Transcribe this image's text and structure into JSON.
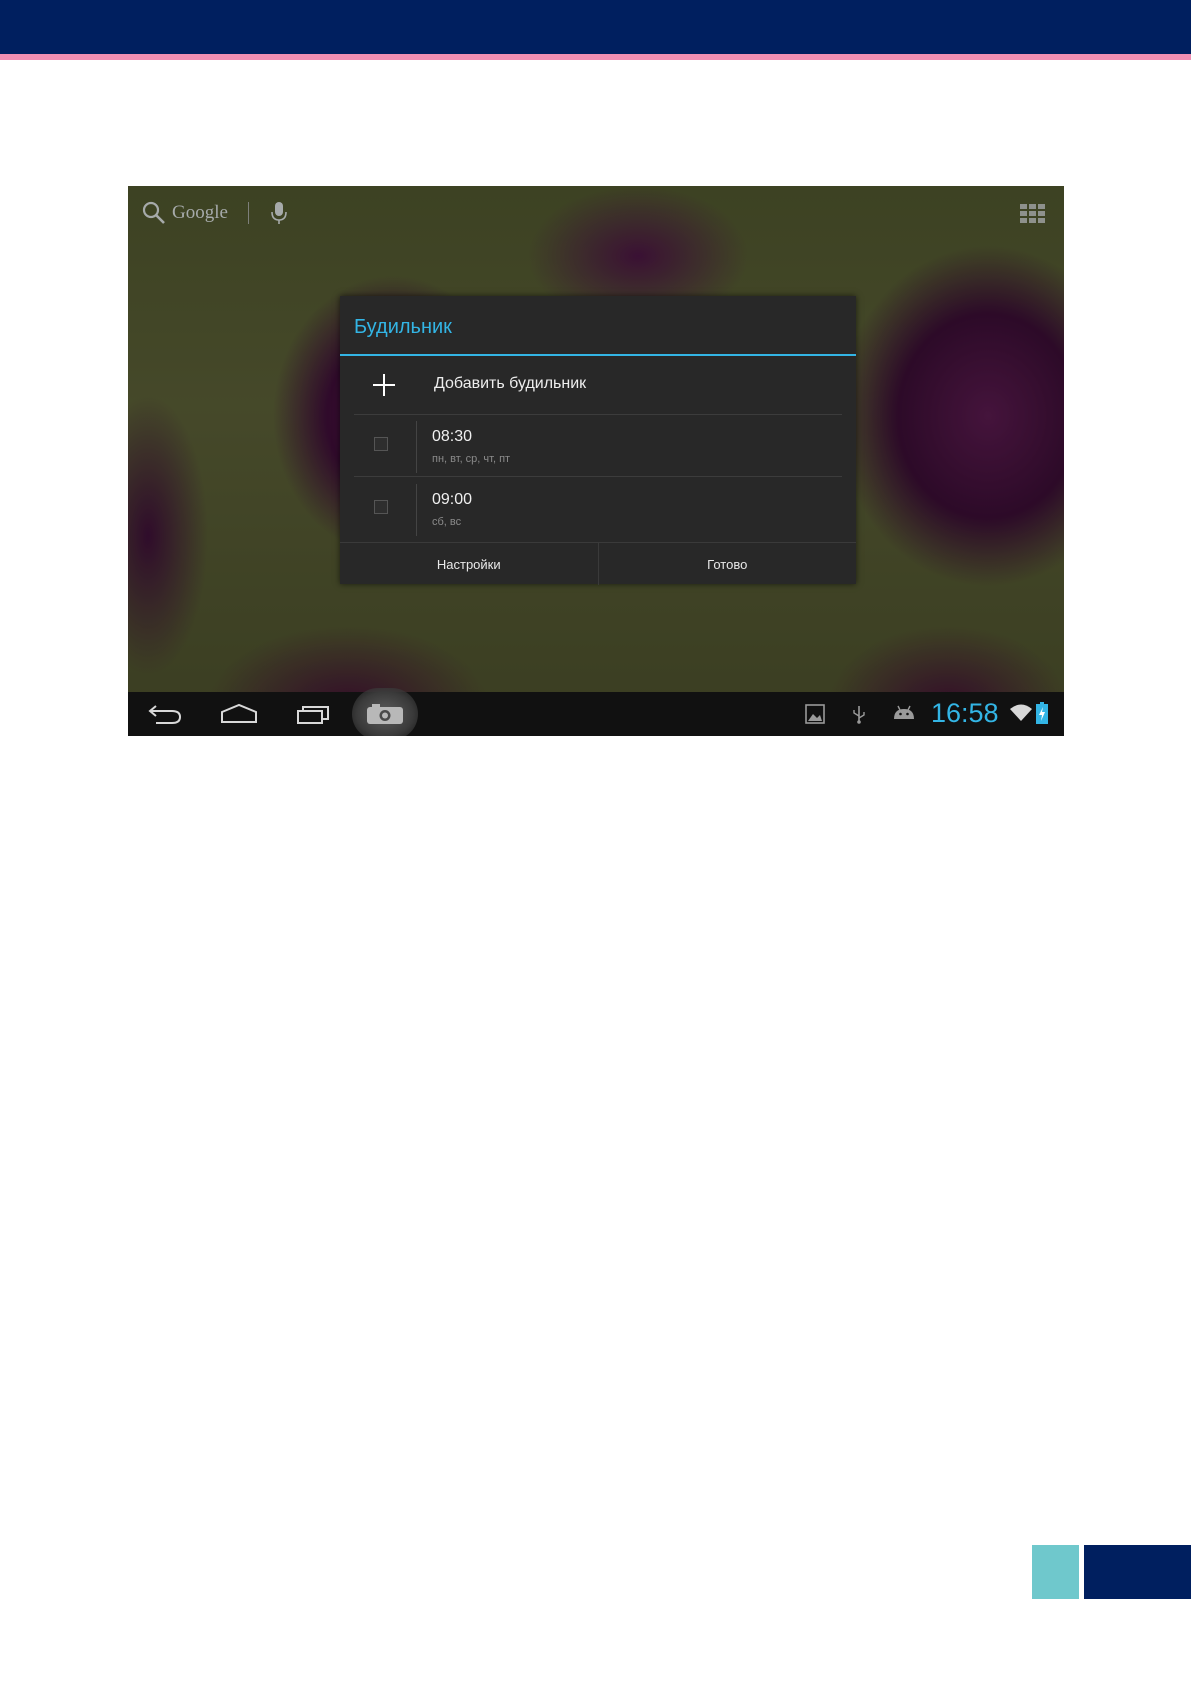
{
  "header": {
    "band_color": "#001f5f",
    "stripe_color": "#f08fb3"
  },
  "home": {
    "search_label": "Google",
    "search_icon": "search-icon",
    "voice_icon": "microphone-icon",
    "apps_icon": "apps-grid-icon"
  },
  "dialog": {
    "title": "Будильник",
    "add_label": "Добавить будильник",
    "alarms": [
      {
        "time": "08:30",
        "days": "пн, вт, ср, чт, пт",
        "enabled": false
      },
      {
        "time": "09:00",
        "days": "сб, вс",
        "enabled": false
      }
    ],
    "settings_label": "Настройки",
    "done_label": "Готово",
    "accent": "#33b5e5"
  },
  "system_bar": {
    "nav_icons": [
      "back-icon",
      "home-icon",
      "recent-apps-icon",
      "screenshot-camera-icon"
    ],
    "status_icons": [
      "gallery-icon",
      "usb-icon",
      "android-debug-icon",
      "wifi-icon",
      "battery-charging-icon"
    ],
    "clock": "16:58"
  },
  "footer": {
    "teal": "#6fc8cc",
    "navy": "#001f5f"
  }
}
